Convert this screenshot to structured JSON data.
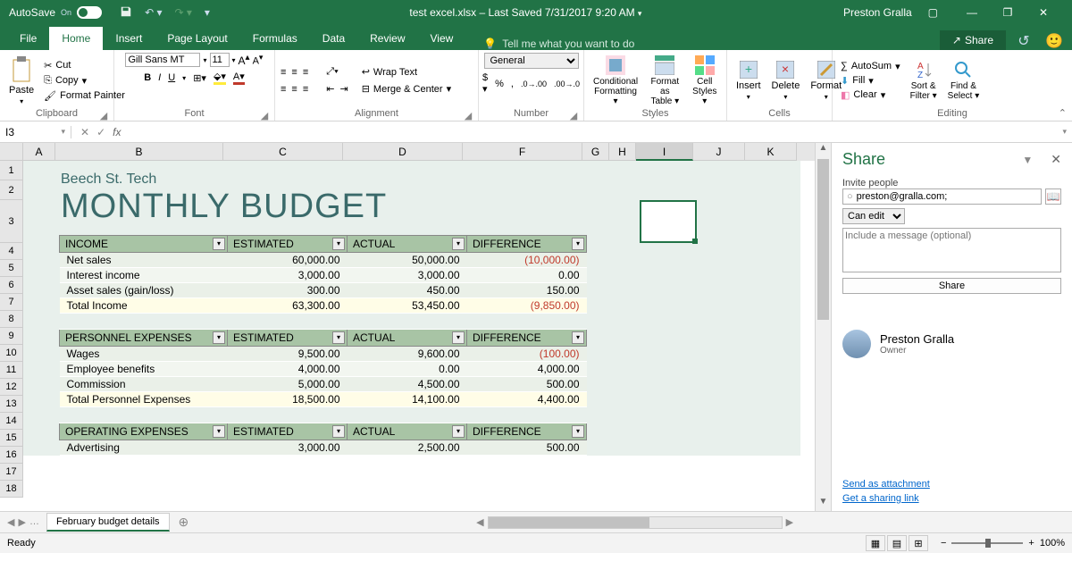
{
  "titlebar": {
    "autosave_label": "AutoSave",
    "autosave_state": "On",
    "doc_title": "test excel.xlsx  –  Last Saved 7/31/2017 9:20 AM",
    "user": "Preston Gralla"
  },
  "tabs": {
    "file": "File",
    "list": [
      "Home",
      "Insert",
      "Page Layout",
      "Formulas",
      "Data",
      "Review",
      "View"
    ],
    "active": "Home",
    "tellme": "Tell me what you want to do",
    "share": "Share"
  },
  "ribbon": {
    "clipboard": {
      "paste": "Paste",
      "cut": "Cut",
      "copy": "Copy",
      "painter": "Format Painter",
      "label": "Clipboard"
    },
    "font": {
      "name": "Gill Sans MT",
      "size": "11",
      "label": "Font"
    },
    "alignment": {
      "wrap": "Wrap Text",
      "merge": "Merge & Center",
      "label": "Alignment"
    },
    "number": {
      "format": "General",
      "label": "Number"
    },
    "styles": {
      "cond": "Conditional Formatting",
      "table": "Format as Table",
      "cell": "Cell Styles",
      "label": "Styles"
    },
    "cells": {
      "insert": "Insert",
      "delete": "Delete",
      "format": "Format",
      "label": "Cells"
    },
    "editing": {
      "autosum": "AutoSum",
      "fill": "Fill",
      "clear": "Clear",
      "sort": "Sort & Filter",
      "find": "Find & Select",
      "label": "Editing"
    }
  },
  "formulabar": {
    "namebox": "I3"
  },
  "columns": [
    "A",
    "B",
    "C",
    "D",
    "F",
    "G",
    "H",
    "I",
    "J",
    "K"
  ],
  "row_numbers": [
    "1",
    "2",
    "3",
    "4",
    "5",
    "6",
    "7",
    "8",
    "9",
    "10",
    "11",
    "12",
    "13",
    "14",
    "15",
    "16",
    "17",
    "18"
  ],
  "budget": {
    "company": "Beech St. Tech",
    "title": "MONTHLY BUDGET",
    "headers": [
      "ESTIMATED",
      "ACTUAL",
      "DIFFERENCE"
    ],
    "income": {
      "label": "INCOME",
      "rows": [
        {
          "name": "Net sales",
          "est": "60,000.00",
          "act": "50,000.00",
          "diff": "(10,000.00)",
          "neg": true
        },
        {
          "name": "Interest income",
          "est": "3,000.00",
          "act": "3,000.00",
          "diff": "0.00"
        },
        {
          "name": "Asset sales (gain/loss)",
          "est": "300.00",
          "act": "450.00",
          "diff": "150.00"
        }
      ],
      "total": {
        "name": "Total Income",
        "est": "63,300.00",
        "act": "53,450.00",
        "diff": "(9,850.00)",
        "neg": true
      }
    },
    "personnel": {
      "label": "PERSONNEL EXPENSES",
      "rows": [
        {
          "name": "Wages",
          "est": "9,500.00",
          "act": "9,600.00",
          "diff": "(100.00)",
          "neg": true
        },
        {
          "name": "Employee benefits",
          "est": "4,000.00",
          "act": "0.00",
          "diff": "4,000.00"
        },
        {
          "name": "Commission",
          "est": "5,000.00",
          "act": "4,500.00",
          "diff": "500.00"
        }
      ],
      "total": {
        "name": "Total Personnel Expenses",
        "est": "18,500.00",
        "act": "14,100.00",
        "diff": "4,400.00"
      }
    },
    "operating": {
      "label": "OPERATING EXPENSES",
      "rows": [
        {
          "name": "Advertising",
          "est": "3,000.00",
          "act": "2,500.00",
          "diff": "500.00"
        }
      ]
    }
  },
  "share": {
    "title": "Share",
    "invite_label": "Invite people",
    "invite_value": "preston@gralla.com;",
    "permission": "Can edit",
    "message_placeholder": "Include a message (optional)",
    "button": "Share",
    "person_name": "Preston Gralla",
    "person_role": "Owner",
    "link_attach": "Send as attachment",
    "link_share": "Get a sharing link"
  },
  "sheet_tab": "February budget details",
  "status": {
    "ready": "Ready",
    "zoom": "100%"
  }
}
